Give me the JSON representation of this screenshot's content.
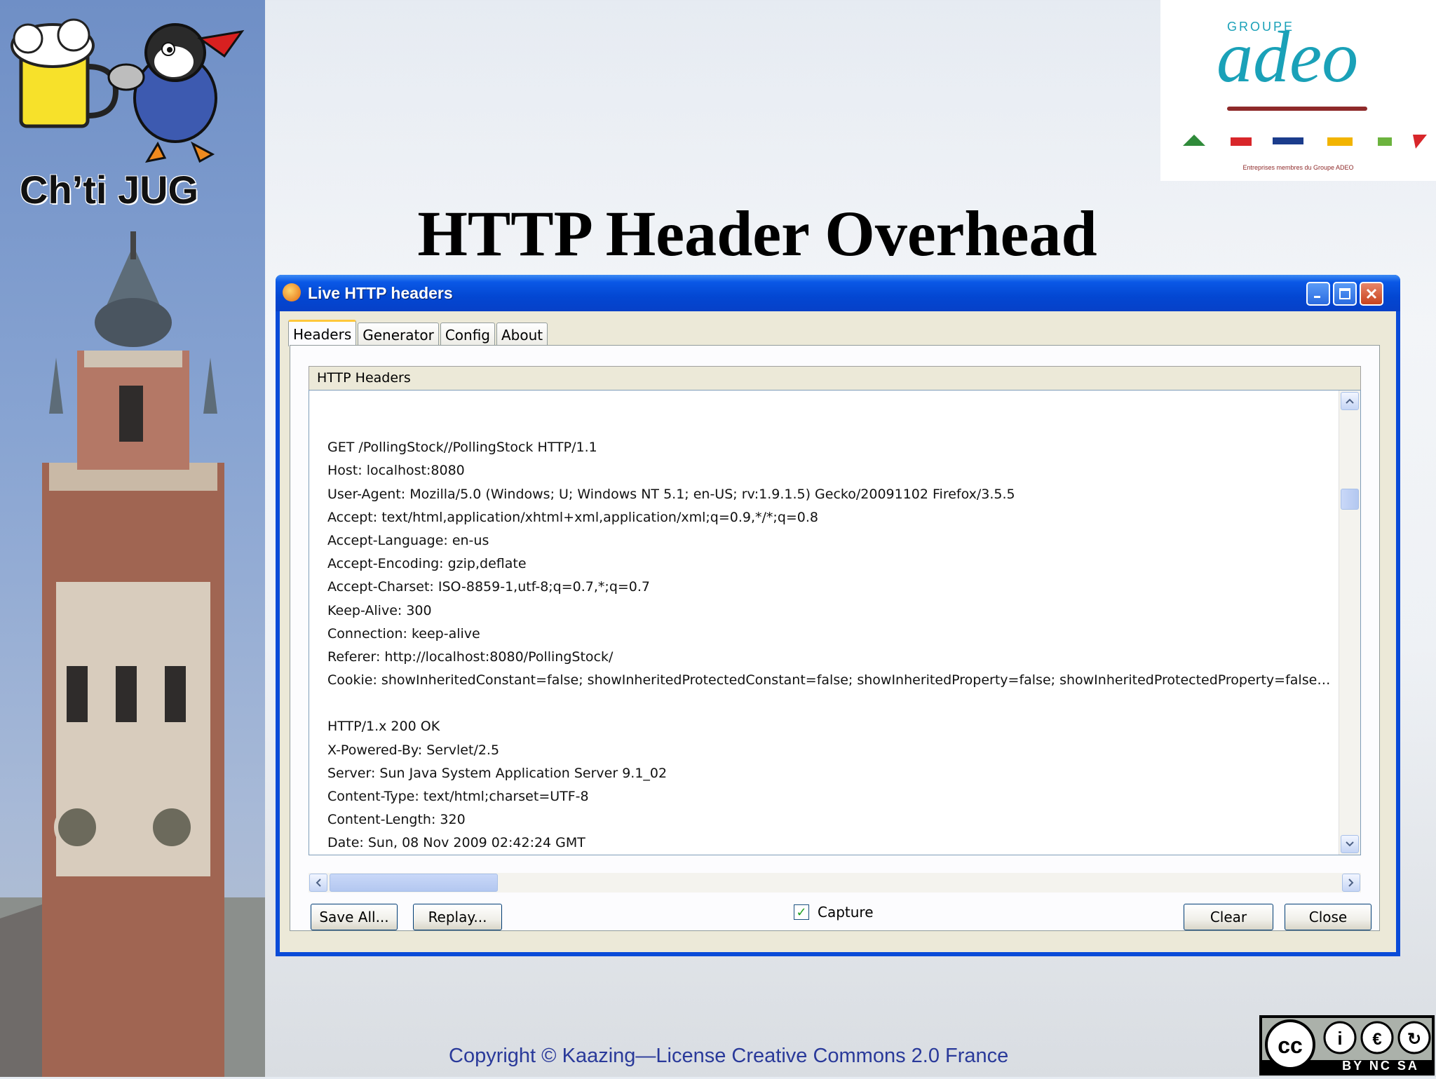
{
  "sidebar": {
    "title": "Ch’ti JUG"
  },
  "logo": {
    "group_label": "GROUPE",
    "brand": "adeo",
    "members_caption": "Entreprises membres du Groupe ADEO"
  },
  "slide": {
    "title": "HTTP Header Overhead",
    "copyright": "Copyright © Kaazing—License Creative Commons 2.0 France",
    "license_badge": "BY NC SA"
  },
  "window": {
    "title": "Live HTTP headers",
    "tabs": [
      {
        "label": "Headers",
        "active": true
      },
      {
        "label": "Generator",
        "active": false
      },
      {
        "label": "Config",
        "active": false
      },
      {
        "label": "About",
        "active": false
      }
    ],
    "group_title": "HTTP Headers",
    "lines": [
      "",
      "GET /PollingStock//PollingStock HTTP/1.1",
      "Host: localhost:8080",
      "User-Agent: Mozilla/5.0 (Windows; U; Windows NT 5.1; en-US; rv:1.9.1.5) Gecko/20091102 Firefox/3.5.5",
      "Accept: text/html,application/xhtml+xml,application/xml;q=0.9,*/*;q=0.8",
      "Accept-Language: en-us",
      "Accept-Encoding: gzip,deflate",
      "Accept-Charset: ISO-8859-1,utf-8;q=0.7,*;q=0.7",
      "Keep-Alive: 300",
      "Connection: keep-alive",
      "Referer: http://localhost:8080/PollingStock/",
      "Cookie: showInheritedConstant=false; showInheritedProtectedConstant=false; showInheritedProperty=false; showInheritedProtectedProperty=false; showIn…",
      "",
      "HTTP/1.x 200 OK",
      "X-Powered-By: Servlet/2.5",
      "Server: Sun Java System Application Server 9.1_02",
      "Content-Type: text/html;charset=UTF-8",
      "Content-Length: 320",
      "Date: Sun, 08 Nov 2009 02:42:24 GMT"
    ],
    "buttons": {
      "save_all": "Save All...",
      "replay": "Replay...",
      "capture_label": "Capture",
      "capture_checked": true,
      "clear": "Clear",
      "close": "Close"
    }
  }
}
